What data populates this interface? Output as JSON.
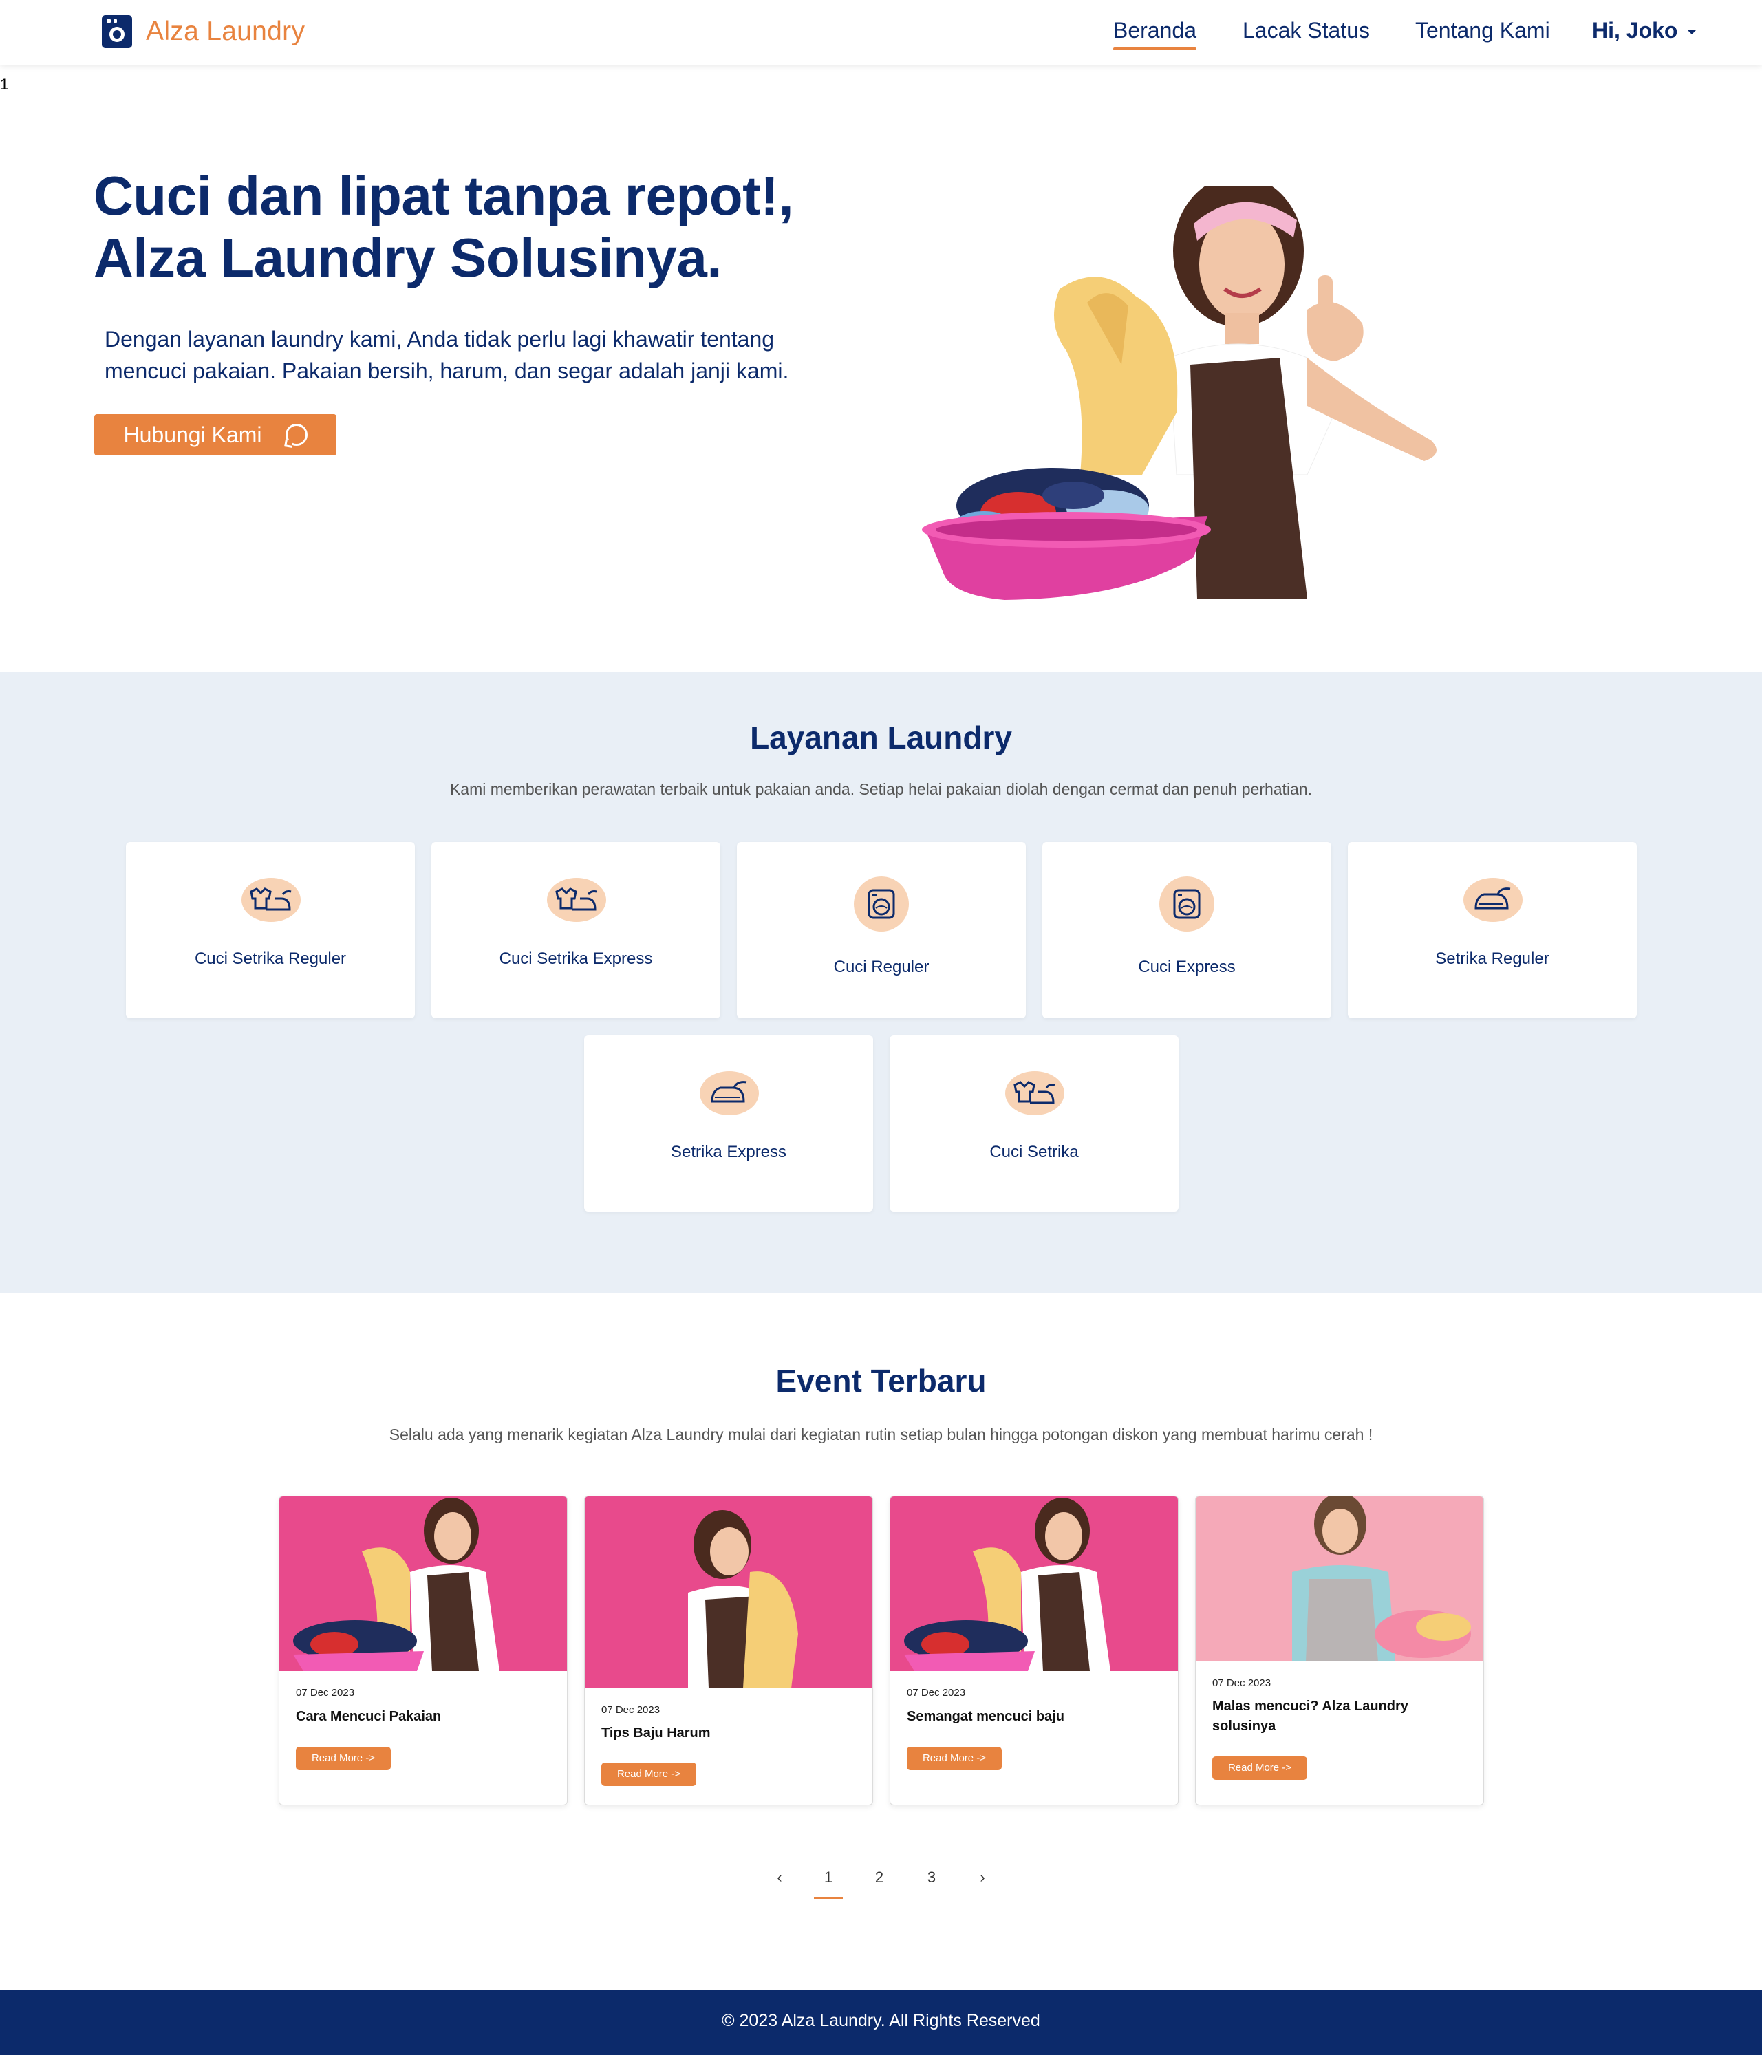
{
  "nav": {
    "brand": "Alza Laundry",
    "links": [
      "Beranda",
      "Lacak Status",
      "Tentang Kami"
    ],
    "user": "Hi, Joko"
  },
  "stray_text": "1",
  "hero": {
    "title_line1": "Cuci dan lipat tanpa repot!,",
    "title_line2": "Alza Laundry Solusinya.",
    "description_line1": "Dengan layanan laundry kami, Anda tidak perlu lagi khawatir tentang",
    "description_line2": "mencuci pakaian. Pakaian bersih, harum, dan segar adalah janji kami.",
    "cta": "Hubungi Kami"
  },
  "services": {
    "title": "Layanan Laundry",
    "subtitle": "Kami memberikan perawatan terbaik untuk pakaian anda. Setiap helai pakaian diolah dengan cermat dan penuh perhatian.",
    "items": [
      {
        "label": "Cuci Setrika Reguler",
        "icon": "iron-clothes-icon"
      },
      {
        "label": "Cuci Setrika Express",
        "icon": "iron-clothes-icon"
      },
      {
        "label": "Cuci Reguler",
        "icon": "washing-machine-icon"
      },
      {
        "label": "Cuci Express",
        "icon": "washing-machine-icon"
      },
      {
        "label": "Setrika Reguler",
        "icon": "iron-icon"
      },
      {
        "label": "Setrika Express",
        "icon": "iron-icon"
      },
      {
        "label": "Cuci Setrika",
        "icon": "iron-clothes-icon"
      }
    ]
  },
  "events": {
    "title": "Event Terbaru",
    "subtitle": "Selalu ada yang menarik kegiatan Alza Laundry mulai dari kegiatan rutin setiap bulan hingga potongan diskon yang membuat harimu cerah !",
    "items": [
      {
        "date": "07 Dec 2023",
        "title": "Cara Mencuci Pakaian",
        "button": "Read More ->"
      },
      {
        "date": "07 Dec 2023",
        "title": "Tips Baju Harum",
        "button": "Read More ->"
      },
      {
        "date": "07 Dec 2023",
        "title": "Semangat mencuci baju",
        "button": "Read More ->"
      },
      {
        "date": "07 Dec 2023",
        "title": "Malas mencuci? Alza Laundry solusinya",
        "button": "Read More ->"
      }
    ]
  },
  "pagination": {
    "prev": "‹",
    "pages": [
      "1",
      "2",
      "3"
    ],
    "next": "›",
    "current": "1"
  },
  "footer": {
    "text": "© 2023 Alza Laundry. All Rights Reserved"
  },
  "colors": {
    "primary": "#0c2a6b",
    "accent": "#e8833f",
    "section_bg": "#e9eff6"
  }
}
